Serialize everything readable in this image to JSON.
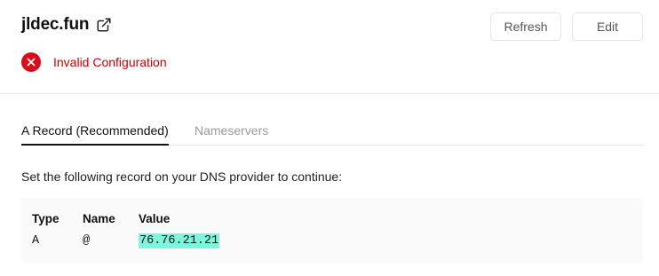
{
  "domain": {
    "name": "jldec.fun",
    "external_icon": "external-link-icon"
  },
  "status": {
    "icon": "x-circle-icon",
    "text": "Invalid Configuration",
    "color": "#d90d1a"
  },
  "toolbar": {
    "refresh_label": "Refresh",
    "edit_label": "Edit"
  },
  "tabs": [
    {
      "label": "A Record (Recommended)",
      "active": true
    },
    {
      "label": "Nameservers",
      "active": false
    }
  ],
  "instructions": "Set the following record on your DNS provider to continue:",
  "record": {
    "headers": [
      "Type",
      "Name",
      "Value"
    ],
    "row": [
      "A",
      "@",
      "76.76.21.21"
    ],
    "value_highlight_color": "#7cf6dc"
  }
}
